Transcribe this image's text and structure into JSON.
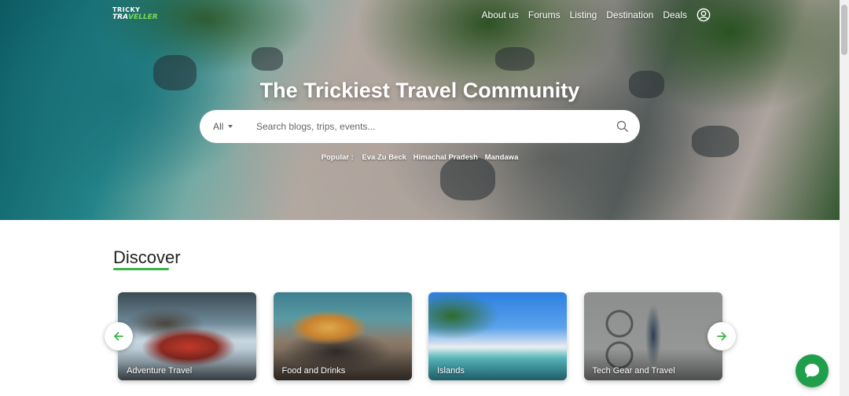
{
  "brand": {
    "logo_line1": "TRICKY",
    "logo_line2a": "TRA",
    "logo_line2b": "VELLER"
  },
  "nav": {
    "items": [
      "About us",
      "Forums",
      "Listing",
      "Destination",
      "Deals"
    ]
  },
  "hero": {
    "title": "The Trickiest Travel Community"
  },
  "search": {
    "category": "All",
    "placeholder": "Search blogs, trips, events..."
  },
  "popular": {
    "label": "Popular :",
    "items": [
      "Eva Zu Beck",
      "Himachal Pradesh",
      "Mandawa"
    ]
  },
  "discover": {
    "title": "Discover",
    "cards": [
      "Adventure Travel",
      "Food and Drinks",
      "Islands",
      "Tech Gear and Travel"
    ]
  },
  "icons": {
    "user": "user-circle-icon",
    "search": "search-icon",
    "prev": "arrow-left-icon",
    "next": "arrow-right-icon",
    "chat": "chat-bubble-icon"
  },
  "colors": {
    "accent": "#3bb54a",
    "chat": "#1f9e4b",
    "logo_accent": "#7ed957"
  }
}
